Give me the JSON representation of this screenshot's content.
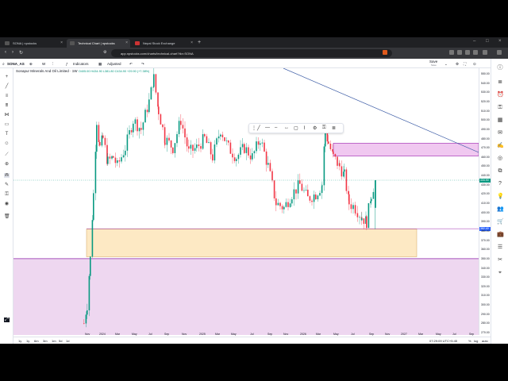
{
  "browser": {
    "tabs": [
      {
        "label": "SONA | npstocks",
        "active": false
      },
      {
        "label": "Technical Chart | npstocks",
        "active": true
      },
      {
        "label": "Nepal Stock Exchange",
        "active": false
      }
    ],
    "url": "app.npstocks.com/charts/technical-chart?tkr=SONA"
  },
  "topbar": {
    "symbol": "SONA_AS",
    "interval": "W",
    "indicators": "Indicators",
    "adjusted": "Adjusted",
    "save": "Save",
    "save_sub": "Save"
  },
  "legend": {
    "title": "Sonapur Minerals And Oil Limited · 1W",
    "values": "O405.00 H434.90 L381.80 C434.90 +29.90 (+7.38%)"
  },
  "price_scale": {
    "ticks": [
      "550.00",
      "540.00",
      "530.00",
      "520.00",
      "510.00",
      "500.00",
      "490.00",
      "480.00",
      "470.00",
      "460.00",
      "450.00",
      "440.00",
      "430.00",
      "420.00",
      "410.00",
      "400.00",
      "390.00",
      "380.00",
      "370.00",
      "360.00",
      "350.00",
      "340.00",
      "330.00",
      "320.00",
      "310.00",
      "300.00",
      "290.00",
      "280.00",
      "270.00"
    ],
    "current_price": "434.90",
    "line_price": "382.40",
    "colors": {
      "current": "#089981",
      "line": "#2962ff"
    }
  },
  "time_axis": {
    "labels": [
      "Nov",
      "2024",
      "Mar",
      "May",
      "Jul",
      "Sep",
      "Nov",
      "2025",
      "Mar",
      "May",
      "Jul",
      "Sep",
      "Nov",
      "2026",
      "Mar",
      "May",
      "Jul",
      "Sep",
      "Nov",
      "2027",
      "Mar",
      "May",
      "Jul",
      "Sep"
    ]
  },
  "bottombar": {
    "ranges": [
      "1y",
      "1y",
      "6m",
      "3m",
      "1m",
      "5d",
      "1d"
    ],
    "clock": "07:29:09 UTC+5:45",
    "pct": "%",
    "log": "log",
    "auto": "auto"
  },
  "colors": {
    "up": "#089981",
    "down": "#f23645",
    "demand_zone": "#fde9c4",
    "supply_zone": "#f0c8f0",
    "lower_zone": "#ecd3ee",
    "trendline": "#3b5ba5"
  },
  "chart_data": {
    "type": "candlestick",
    "ylim": [
      265,
      555
    ],
    "visible_last": {
      "open": 405.0,
      "high": 434.9,
      "low": 381.8,
      "close": 434.9
    }
  }
}
